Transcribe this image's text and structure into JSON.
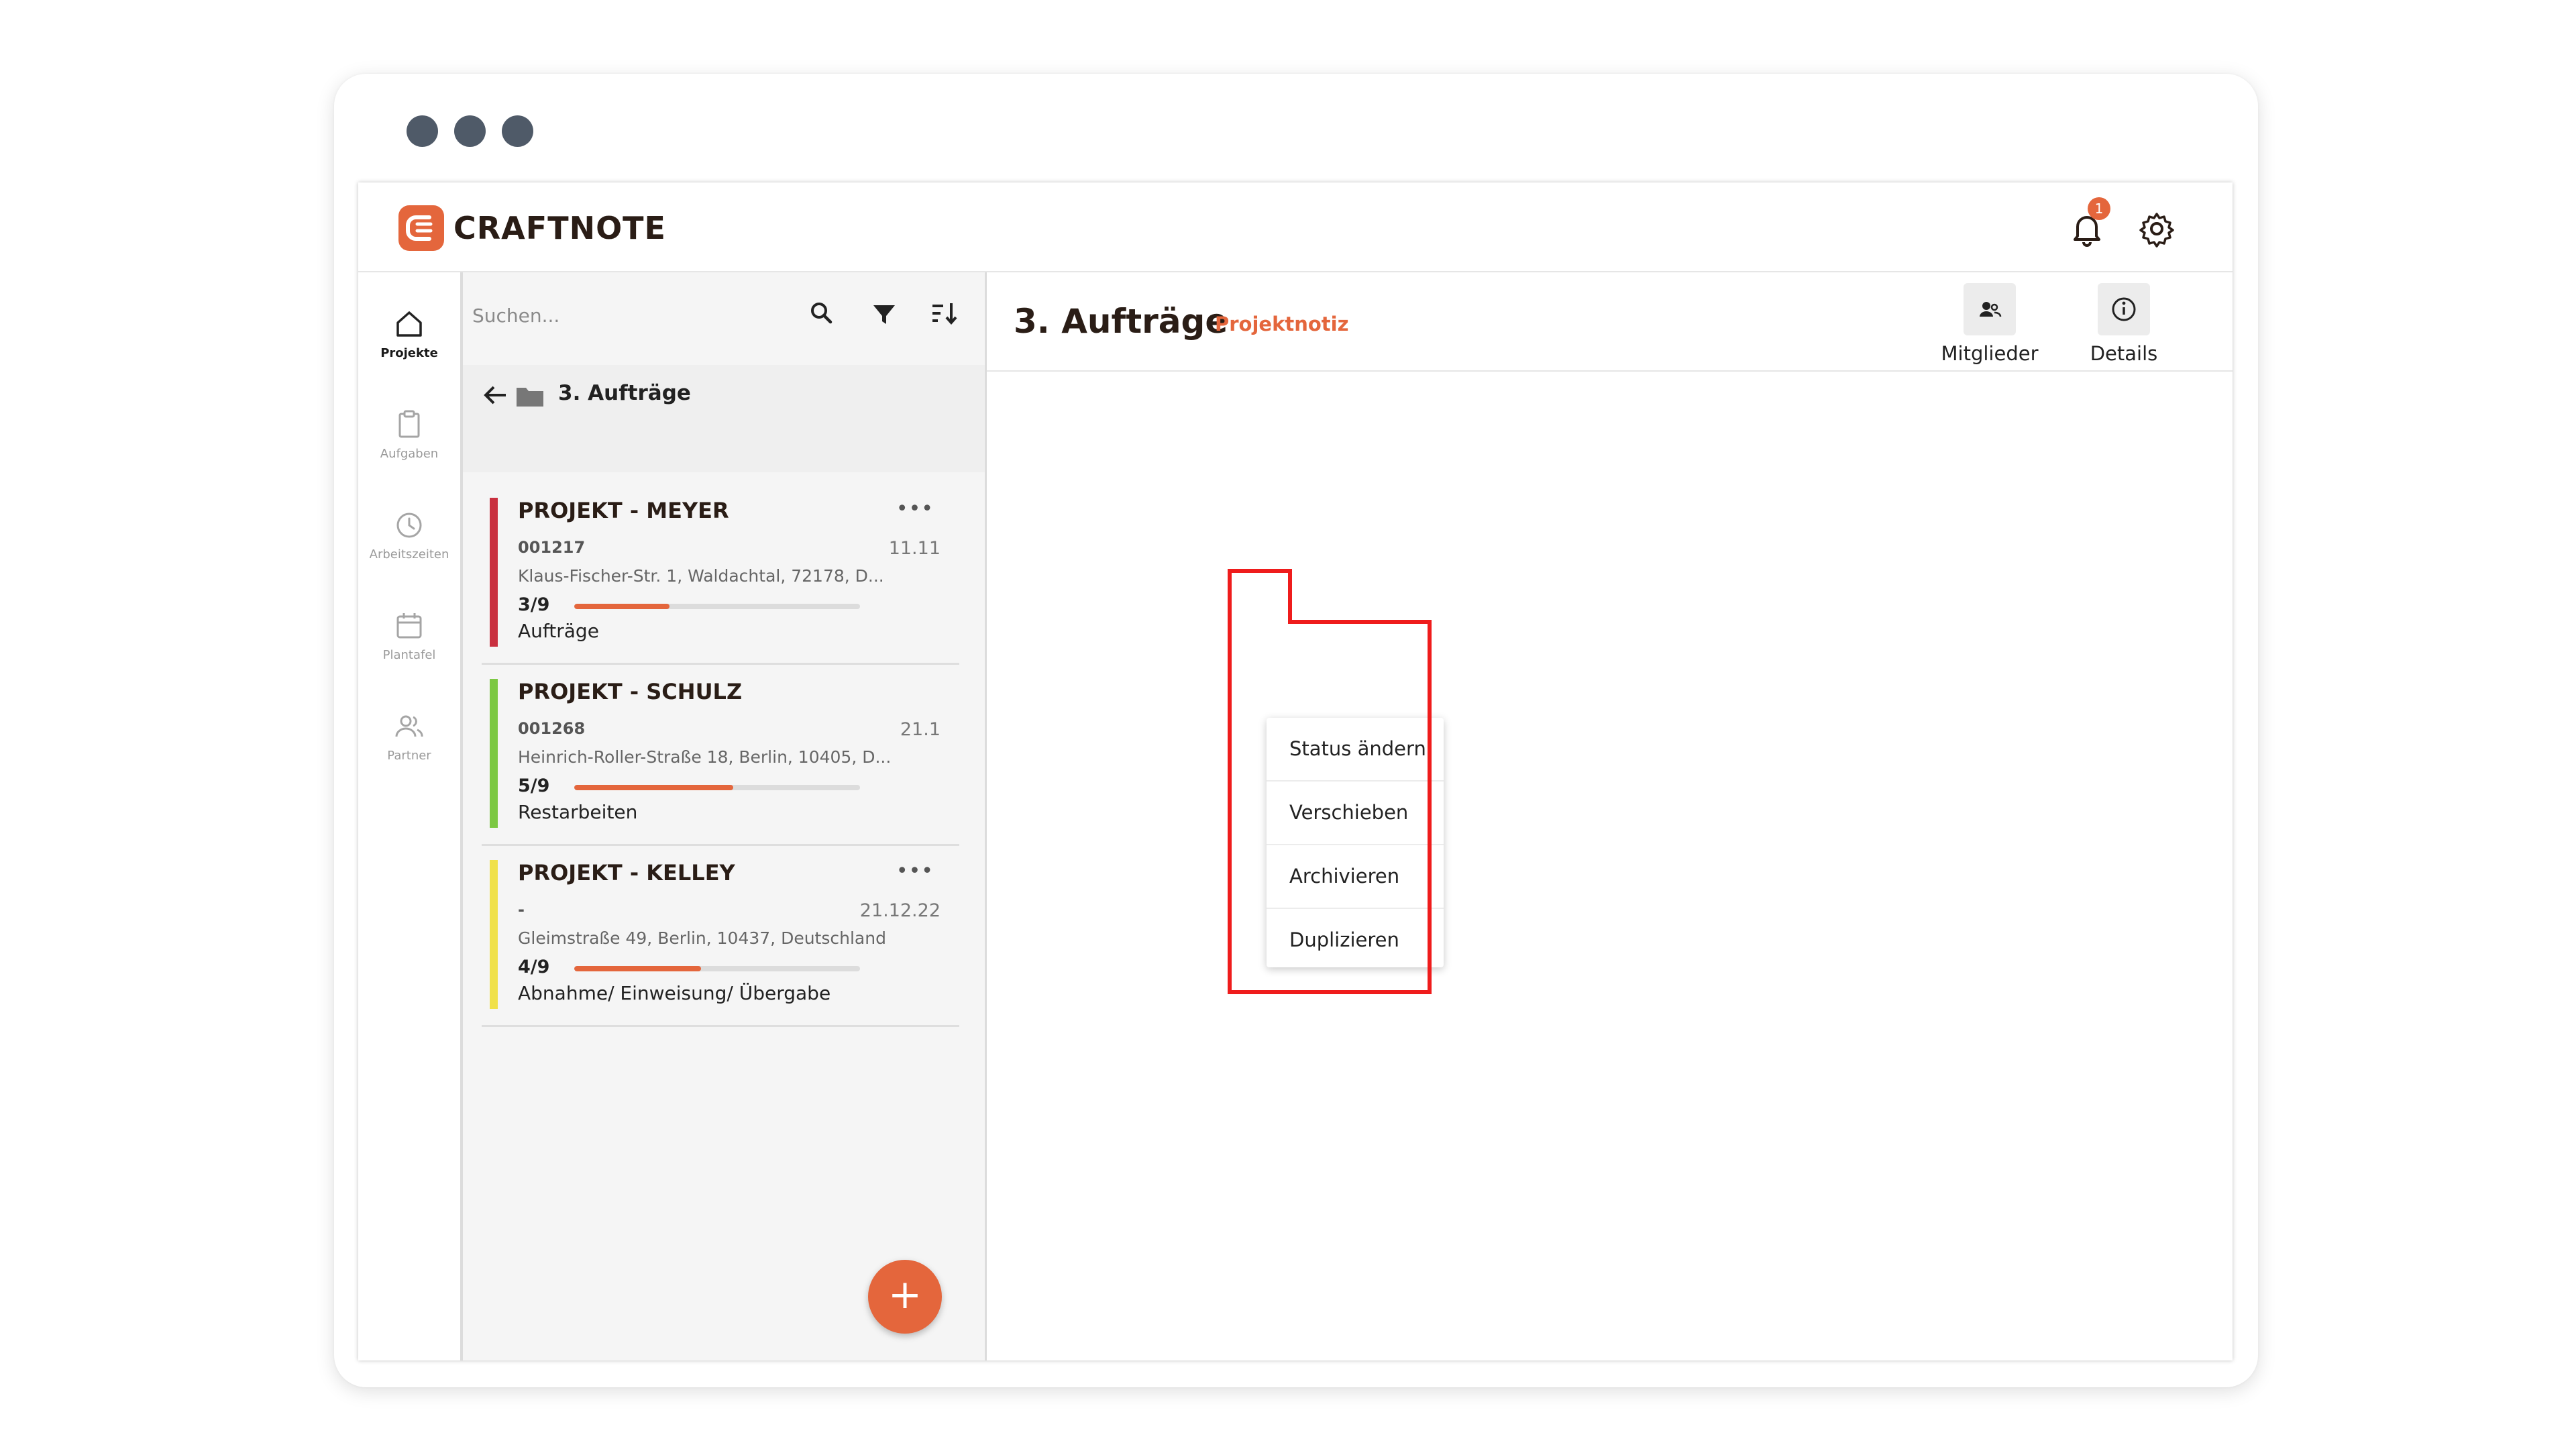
{
  "window": {
    "controls": [
      "dot",
      "dot",
      "dot"
    ]
  },
  "app": {
    "logo_text": "CRAFTNOTE",
    "notifications_count": "1"
  },
  "nav": {
    "items": [
      {
        "label": "Projekte",
        "icon": "home-icon",
        "active": true
      },
      {
        "label": "Aufgaben",
        "icon": "clipboard-icon",
        "active": false
      },
      {
        "label": "Arbeitszeiten",
        "icon": "clock-icon",
        "active": false
      },
      {
        "label": "Plantafel",
        "icon": "calendar-icon",
        "active": false
      },
      {
        "label": "Partner",
        "icon": "people-icon",
        "active": false
      }
    ]
  },
  "list": {
    "search_placeholder": "Suchen...",
    "folder_title": "3. Aufträge",
    "projects": [
      {
        "title": "PROJEKT - MEYER",
        "number": "001217",
        "date": "11.11",
        "address": "Klaus-Fischer-Str. 1, Waldachtal, 72178, D...",
        "progress_label": "3/9",
        "progress": 0.333,
        "status": "Aufträge",
        "color": "#c9303f"
      },
      {
        "title": "PROJEKT - SCHULZ",
        "number": "001268",
        "date": "21.1",
        "address": "Heinrich-Roller-Straße 18, Berlin, 10405, D...",
        "progress_label": "5/9",
        "progress": 0.556,
        "status": "Restarbeiten",
        "color": "#7cc843"
      },
      {
        "title": "PROJEKT - KELLEY",
        "number": "-",
        "date": "21.12.22",
        "address": "Gleimstraße 49, Berlin, 10437, Deutschland",
        "progress_label": "4/9",
        "progress": 0.444,
        "status": "Abnahme/ Einweisung/ Übergabe",
        "color": "#f0e14a"
      }
    ],
    "more_glyph": "•••",
    "fab_label": "+"
  },
  "main": {
    "title": "3. Aufträge",
    "subtitle": "Projektnotiz",
    "members_label": "Mitglieder",
    "details_label": "Details"
  },
  "context_menu": {
    "items": [
      "Status ändern",
      "Verschieben",
      "Archivieren",
      "Duplizieren"
    ]
  },
  "colors": {
    "accent": "#e4663c",
    "highlight": "#ef1c1c"
  }
}
